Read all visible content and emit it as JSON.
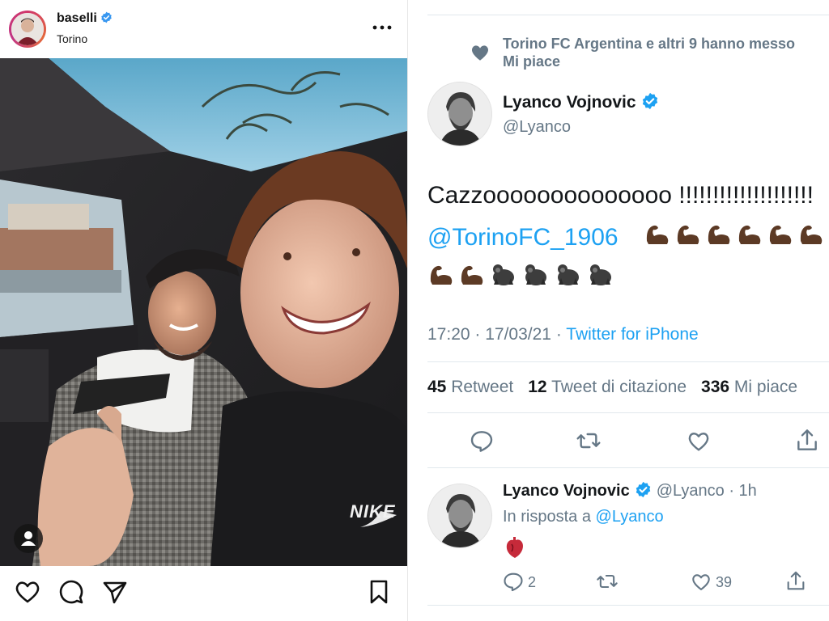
{
  "instagram": {
    "username": "baselli",
    "location": "Torino",
    "photo_brand_text": "NIKE"
  },
  "twitter": {
    "likes_text": "Torino FC Argentina e altri 9 hanno messo",
    "likes_text_line2": "Mi piace",
    "tweet": {
      "author_name": "Lyanco Vojnovic",
      "author_handle": "@Lyanco",
      "body_line1": "Cazzoooooooooooooo !!!!!!!!!!!!!!!!!!!!",
      "mention": "@TorinoFC_1906",
      "time": "17:20",
      "date_sep": " · ",
      "date": "17/03/21",
      "source_sep": " · ",
      "source": "Twitter for iPhone",
      "retweets": "45",
      "retweets_label": "Retweet",
      "quotes": "12",
      "quotes_label": "Tweet di citazione",
      "likes": "336",
      "likes_label": "Mi piace"
    },
    "reply": {
      "author_name": "Lyanco Vojnovic",
      "author_handle": "@Lyanco",
      "time_ago": "1h",
      "in_reply_prefix": "In risposta a",
      "in_reply_handle": "@Lyanco",
      "reply_count": "2",
      "like_count": "39"
    },
    "colors": {
      "accent": "#1da1f2",
      "secondary_text": "#657786",
      "text": "#14171a"
    },
    "icons": [
      "heart-icon",
      "verified-badge-icon",
      "reply-icon",
      "retweet-icon",
      "share-icon",
      "flexed-biceps-emoji",
      "gorilla-emoji",
      "anatomical-heart-emoji"
    ]
  }
}
